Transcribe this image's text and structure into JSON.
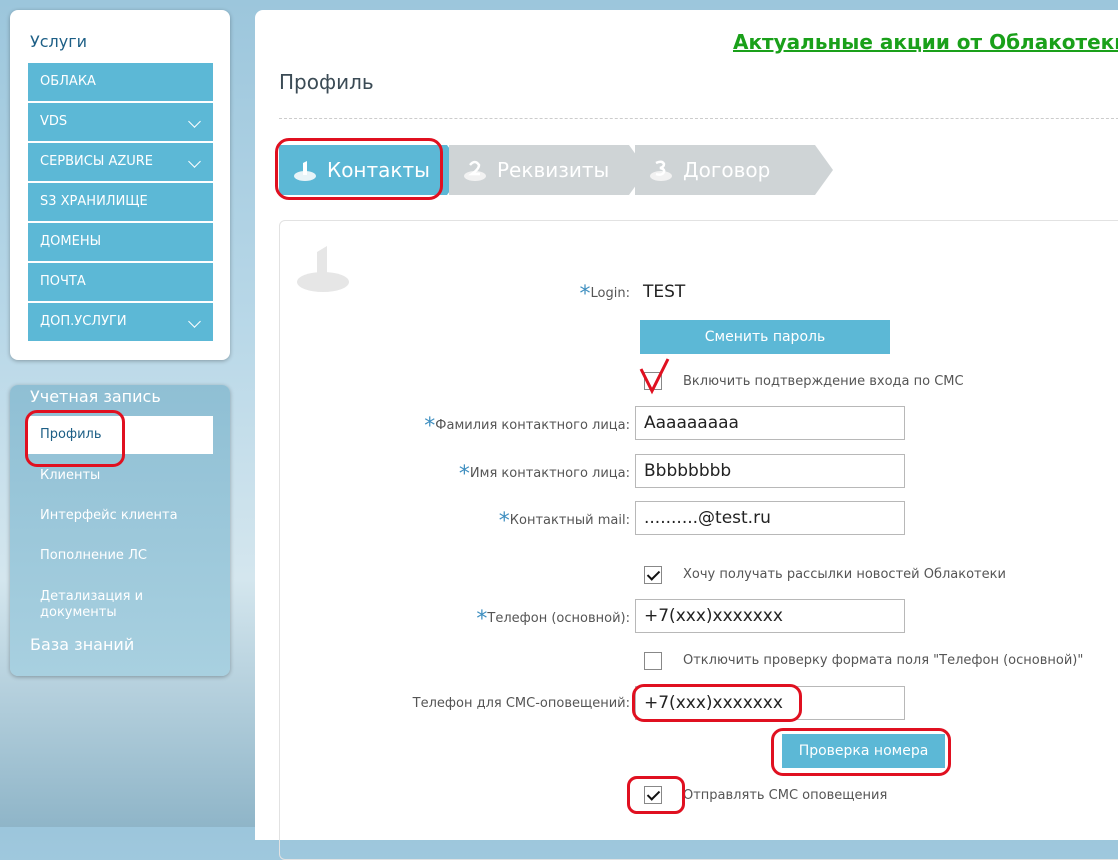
{
  "sidebar": {
    "services_title": "Услуги",
    "items": [
      {
        "label": "ОБЛАКА",
        "expandable": false
      },
      {
        "label": "VDS",
        "expandable": true
      },
      {
        "label": "СЕРВИСЫ AZURE",
        "expandable": true
      },
      {
        "label": "S3 ХРАНИЛИЩЕ",
        "expandable": false
      },
      {
        "label": "ДОМЕНЫ",
        "expandable": false
      },
      {
        "label": "ПОЧТА",
        "expandable": false
      },
      {
        "label": "ДОП.УСЛУГИ",
        "expandable": true
      }
    ],
    "account_title": "Учетная запись",
    "account_items": [
      {
        "label": "Профиль",
        "active": true
      },
      {
        "label": "Клиенты"
      },
      {
        "label": "Интерфейс клиента"
      },
      {
        "label": "Пополнение ЛС"
      },
      {
        "label": "Детализация и документы"
      }
    ],
    "knowledge_base": "База знаний"
  },
  "header": {
    "promo": "Актуальные акции от Облакотеки",
    "page_title": "Профиль"
  },
  "steps": [
    {
      "label": "Контакты",
      "active": true
    },
    {
      "label": "Реквизиты",
      "active": false
    },
    {
      "label": "Договор",
      "active": false
    }
  ],
  "form": {
    "login_label": "Login:",
    "login_value": "TEST",
    "change_password": "Сменить пароль",
    "sms_login_label": "Включить подтверждение входа по СМС",
    "sms_login_checked": false,
    "lastname_label": "Фамилия контактного лица:",
    "lastname_value": "Ааааааааа",
    "firstname_label": "Имя контактного лица:",
    "firstname_value": "Bbbbbbbb",
    "mail_label": "Контактный mail:",
    "mail_value": "..........@test.ru",
    "newsletter_label": "Хочу получать рассылки новостей Облакотеки",
    "newsletter_checked": true,
    "phone_label": "Телефон (основной):",
    "phone_value": "+7(xxx)xxxxxxx",
    "disable_check_label": "Отключить проверку формата поля \"Телефон (основной)\"",
    "disable_check_checked": false,
    "sms_phone_label": "Телефон для СМС-оповещений:",
    "sms_phone_value": "+7(xxx)xxxxxxx",
    "verify_button": "Проверка номера",
    "send_sms_label": "Отправлять СМС оповещения",
    "send_sms_checked": true
  },
  "colors": {
    "accent": "#5cb8d6",
    "annotation": "#e01020",
    "promo": "#1aa01a"
  }
}
